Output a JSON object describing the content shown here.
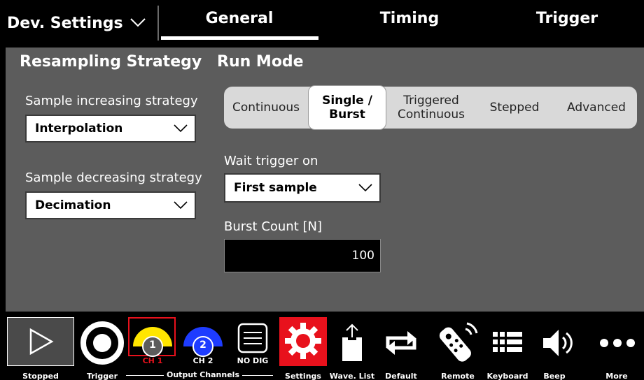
{
  "header": {
    "dev_settings_label": "Dev. Settings",
    "tabs": [
      {
        "label": "General",
        "active": true
      },
      {
        "label": "Timing",
        "active": false
      },
      {
        "label": "Trigger",
        "active": false
      }
    ]
  },
  "resampling": {
    "title": "Resampling Strategy",
    "increasing_label": "Sample increasing strategy",
    "increasing_value": "Interpolation",
    "decreasing_label": "Sample decreasing strategy",
    "decreasing_value": "Decimation"
  },
  "run_mode": {
    "title": "Run Mode",
    "modes": [
      {
        "line1": "Continuous",
        "line2": "",
        "active": false
      },
      {
        "line1": "Single /",
        "line2": "Burst",
        "active": true
      },
      {
        "line1": "Triggered",
        "line2": "Continuous",
        "active": false
      },
      {
        "line1": "Stepped",
        "line2": "",
        "active": false
      },
      {
        "line1": "Advanced",
        "line2": "",
        "active": false
      }
    ],
    "wait_trigger_label": "Wait trigger on",
    "wait_trigger_value": "First sample",
    "burst_count_label": "Burst Count [N]",
    "burst_count_value": "100"
  },
  "toolbar": {
    "stopped": "Stopped",
    "trigger": "Trigger",
    "output_channels": "Output Channels",
    "ch1_number": "1",
    "ch1_label": "CH 1",
    "ch2_number": "2",
    "ch2_label": "CH 2",
    "no_dig": "NO DIG",
    "settings": "Settings",
    "wave_list": "Wave. List",
    "default": "Default",
    "remote": "Remote",
    "keyboard": "Keyboard",
    "beep": "Beep",
    "more": "More"
  },
  "colors": {
    "ch1": "#ffe600",
    "ch2": "#1e3cff",
    "settings_bg": "#e8111c",
    "panel_bg": "#5c5c5c"
  }
}
